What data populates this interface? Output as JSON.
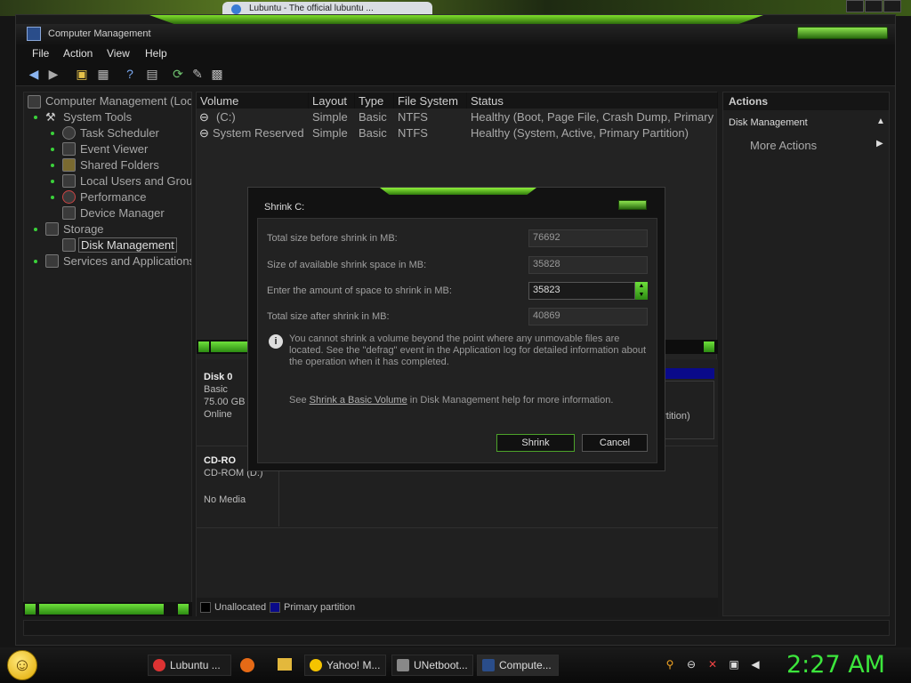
{
  "window": {
    "title": "Computer Management"
  },
  "menu": [
    "File",
    "Action",
    "View",
    "Help"
  ],
  "tree": {
    "root": "Computer Management (Loc",
    "items": [
      "System Tools",
      "Task Scheduler",
      "Event Viewer",
      "Shared Folders",
      "Local Users and Grou",
      "Performance",
      "Device Manager",
      "Storage",
      "Disk Management",
      "Services and Applications"
    ]
  },
  "volumes": {
    "headers": [
      "Volume",
      "Layout",
      "Type",
      "File System",
      "Status"
    ],
    "rows": [
      [
        "(C:)",
        "Simple",
        "Basic",
        "NTFS",
        "Healthy (Boot, Page File, Crash Dump, Primary"
      ],
      [
        "System Reserved",
        "Simple",
        "Basic",
        "NTFS",
        "Healthy (System, Active, Primary Partition)"
      ]
    ]
  },
  "disks": {
    "disk0": {
      "name": "Disk 0",
      "type": "Basic",
      "size": "75.00 GB",
      "state": "Online",
      "partition_tail": "artition)"
    },
    "cdrom": {
      "name": "CD-RO",
      "type": "CD-ROM (D:)",
      "media": "No Media"
    }
  },
  "legend": {
    "unallocated": "Unallocated",
    "primary": "Primary partition"
  },
  "actions": {
    "header": "Actions",
    "section": "Disk Management",
    "more": "More Actions"
  },
  "dialog": {
    "title": "Shrink C:",
    "labels": [
      "Total size before shrink in MB:",
      "Size of available shrink space in MB:",
      "Enter the amount of space to shrink in MB:",
      "Total size after shrink in MB:"
    ],
    "values": [
      "76692",
      "35828",
      "35823",
      "40869"
    ],
    "info": "You cannot shrink a volume beyond the point where any unmovable files are located. See the \"defrag\" event in the Application log for detailed information about the operation when it has completed.",
    "help_prefix": "See ",
    "help_link": "Shrink a Basic Volume",
    "help_suffix": " in Disk Management help for more information.",
    "shrink": "Shrink",
    "cancel": "Cancel"
  },
  "browser_tab": "Lubuntu - The official lubuntu ...",
  "taskbar": {
    "tasks": [
      "Lubuntu ...",
      "Yahoo! M...",
      "UNetboot...",
      "Compute..."
    ],
    "clock": "2:27 AM"
  },
  "colors": {
    "accent_green": "#3ce63c",
    "primary_partition": "#0a0a8a"
  }
}
